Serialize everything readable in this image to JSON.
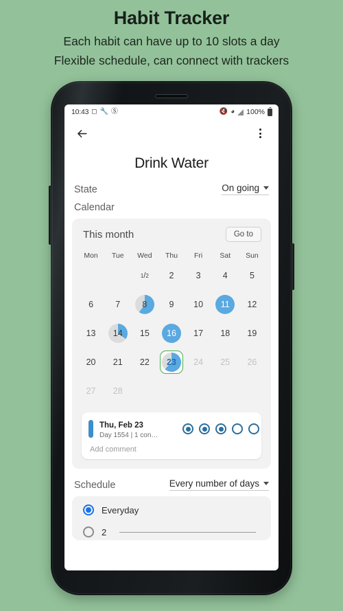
{
  "promo": {
    "title": "Habit Tracker",
    "subtitle_line1": "Each habit can have up to 10 slots a day",
    "subtitle_line2": "Flexible schedule, can connect with trackers"
  },
  "colors": {
    "background": "#93c29a",
    "accent_blue": "#5aa9e0",
    "today_green": "#4caf50",
    "slot_blue": "#2a6f9e",
    "radio_blue": "#1a73e8"
  },
  "statusbar": {
    "time": "10:43",
    "left_icons": [
      "no-sim-icon",
      "wrench-icon",
      "do-not-disturb-icon"
    ],
    "right_icons": [
      "mute-icon",
      "wifi-icon",
      "signal-icon"
    ],
    "battery_percent": "100%"
  },
  "appbar": {
    "back_icon": "back-arrow-icon",
    "overflow_icon": "overflow-menu-icon"
  },
  "page_title": "Drink Water",
  "state": {
    "label": "State",
    "value": "On going"
  },
  "calendar_label": "Calendar",
  "calendar": {
    "title": "This month",
    "goto_label": "Go to",
    "weekdays": [
      "Mon",
      "Tue",
      "Wed",
      "Thu",
      "Fri",
      "Sat",
      "Sun"
    ],
    "rows": [
      [
        {
          "type": "empty"
        },
        {
          "type": "empty"
        },
        {
          "type": "fraction",
          "numerator": "1",
          "denominator": "2"
        },
        {
          "type": "day",
          "num": "2"
        },
        {
          "type": "day",
          "num": "3"
        },
        {
          "type": "day",
          "num": "4"
        },
        {
          "type": "day",
          "num": "5"
        }
      ],
      [
        {
          "type": "day",
          "num": "6"
        },
        {
          "type": "day",
          "num": "7"
        },
        {
          "type": "day",
          "num": "8",
          "fill": 60
        },
        {
          "type": "day",
          "num": "9"
        },
        {
          "type": "day",
          "num": "10"
        },
        {
          "type": "day",
          "num": "11",
          "fill": 100
        },
        {
          "type": "day",
          "num": "12"
        }
      ],
      [
        {
          "type": "day",
          "num": "13"
        },
        {
          "type": "day",
          "num": "14",
          "fill": 35
        },
        {
          "type": "day",
          "num": "15"
        },
        {
          "type": "day",
          "num": "16",
          "fill": 100
        },
        {
          "type": "day",
          "num": "17"
        },
        {
          "type": "day",
          "num": "18"
        },
        {
          "type": "day",
          "num": "19"
        }
      ],
      [
        {
          "type": "day",
          "num": "20"
        },
        {
          "type": "day",
          "num": "21"
        },
        {
          "type": "day",
          "num": "22"
        },
        {
          "type": "day",
          "num": "23",
          "fill": 62,
          "today": true
        },
        {
          "type": "day",
          "num": "24",
          "muted": true
        },
        {
          "type": "day",
          "num": "25",
          "muted": true
        },
        {
          "type": "day",
          "num": "26",
          "muted": true
        }
      ],
      [
        {
          "type": "day",
          "num": "27",
          "muted": true
        },
        {
          "type": "day",
          "num": "28",
          "muted": true
        },
        {
          "type": "empty"
        },
        {
          "type": "empty"
        },
        {
          "type": "empty"
        },
        {
          "type": "empty"
        },
        {
          "type": "empty"
        }
      ]
    ]
  },
  "entry": {
    "date": "Thu, Feb 23",
    "subtitle": "Day 1554 | 1 con…",
    "slots": [
      true,
      true,
      true,
      false,
      false
    ],
    "add_comment_placeholder": "Add comment"
  },
  "schedule": {
    "label": "Schedule",
    "mode": "Every number of days",
    "options": [
      {
        "label": "Everyday",
        "selected": true
      },
      {
        "label": "2",
        "selected": false
      }
    ]
  }
}
